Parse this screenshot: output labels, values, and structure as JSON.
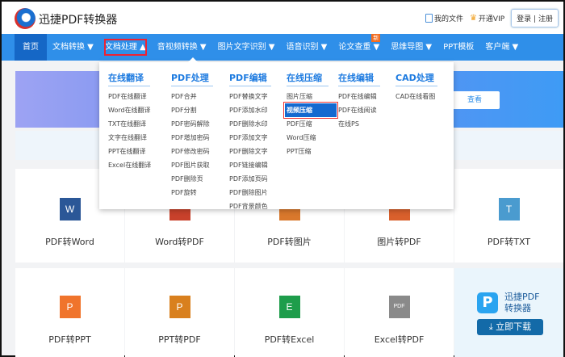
{
  "header": {
    "brand": "迅捷PDF转换器",
    "my_files": "我的文件",
    "vip": "开通VIP",
    "login": "登录",
    "register": "注册",
    "sep": "|"
  },
  "nav": [
    {
      "label": "首页"
    },
    {
      "label": "文档转换 ▼"
    },
    {
      "label": "文档处理 ▲"
    },
    {
      "label": "音视频转换 ▼"
    },
    {
      "label": "图片文字识别 ▼"
    },
    {
      "label": "语音识别 ▼"
    },
    {
      "label": "论文查重 ▼",
      "badge": "新"
    },
    {
      "label": "思维导图 ▼"
    },
    {
      "label": "PPT模板"
    },
    {
      "label": "客户端 ▼"
    }
  ],
  "banner": {
    "button": "查看"
  },
  "dropdown": [
    {
      "title": "在线翻译",
      "items": [
        "PDF在线翻译",
        "Word在线翻译",
        "TXT在线翻译",
        "文字在线翻译",
        "PPT在线翻译",
        "Excel在线翻译"
      ]
    },
    {
      "title": "PDF处理",
      "items": [
        "PDF合并",
        "PDF分割",
        "PDF密码解除",
        "PDF增加密码",
        "PDF修改密码",
        "PDF图片获取",
        "PDF删除页",
        "PDF旋转"
      ]
    },
    {
      "title": "PDF编辑",
      "items": [
        "PDF替换文字",
        "PDF添加水印",
        "PDF删除水印",
        "PDF添加文字",
        "PDF删除文字",
        "PDF链接编辑",
        "PDF添加页码",
        "PDF删除图片",
        "PDF背景颜色"
      ]
    },
    {
      "title": "在线压缩",
      "items": [
        "图片压缩",
        "视频压缩",
        "PDF压缩",
        "Word压缩",
        "PPT压缩"
      ],
      "selected": 1
    },
    {
      "title": "在线编辑",
      "items": [
        "PDF在线编辑",
        "PDF在线阅读",
        "在线PS"
      ]
    },
    {
      "title": "CAD处理",
      "items": [
        "CAD在线看图"
      ]
    }
  ],
  "tools_row1": [
    {
      "label": "PDF转Word",
      "glyph": "W",
      "color": "#2b5797"
    },
    {
      "label": "Word转PDF",
      "glyph": "",
      "color": "#c8412b"
    },
    {
      "label": "PDF转图片",
      "glyph": "",
      "color": "#d9782c"
    },
    {
      "label": "图片转PDF",
      "glyph": "",
      "color": "#d9602c"
    },
    {
      "label": "PDF转TXT",
      "glyph": "T",
      "color": "#4a9bcf"
    }
  ],
  "tools_row2": [
    {
      "label": "PDF转PPT",
      "glyph": "P",
      "color": "#f0742c"
    },
    {
      "label": "PPT转PDF",
      "glyph": "P",
      "color": "#d9801e"
    },
    {
      "label": "PDF转Excel",
      "glyph": "E",
      "color": "#1e9d4b"
    },
    {
      "label": "Excel转PDF",
      "glyph": "PDF",
      "color": "#8a8a8a"
    }
  ],
  "promo": {
    "logo": "P",
    "line1": "迅捷PDF",
    "line2": "转换器",
    "download": "立即下载"
  }
}
